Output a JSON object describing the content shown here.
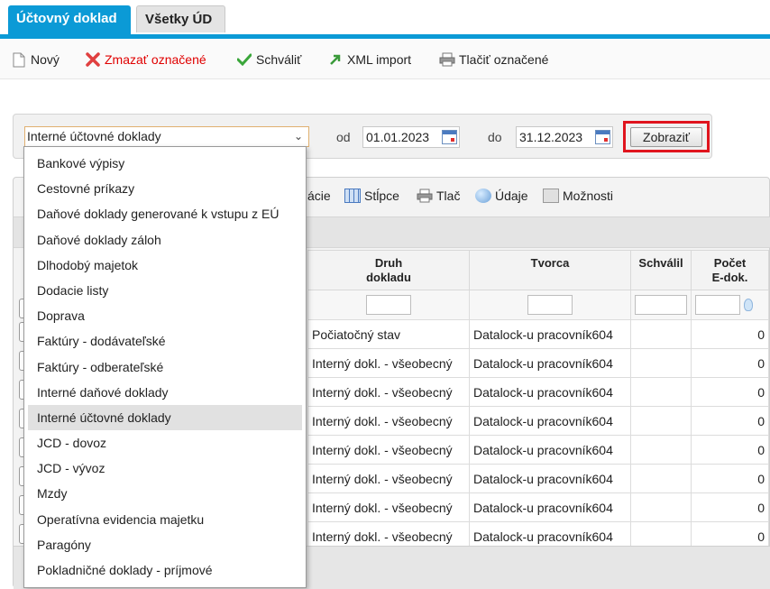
{
  "tabs": [
    {
      "label": "Účtovný doklad",
      "active": true
    },
    {
      "label": "Všetky ÚD",
      "active": false
    }
  ],
  "toolbar": {
    "new": "Nový",
    "delete": "Zmazať označené",
    "approve": "Schváliť",
    "xml_import": "XML import",
    "print": "Tlačiť označené"
  },
  "filter": {
    "type_value": "Interné účtovné doklady",
    "from_label": "od",
    "from_date": "01.01.2023",
    "to_label": "do",
    "to_date": "31.12.2023",
    "show_button": "Zobraziť"
  },
  "grid_toolbar": {
    "actions_partial": "ácie",
    "columns": "Stĺpce",
    "print": "Tlač",
    "data": "Údaje",
    "options": "Možnosti"
  },
  "table": {
    "headers": [
      "Druh dokladu",
      "Tvorca",
      "Schválil",
      "Počet E-dok."
    ],
    "rows": [
      {
        "type": "Počiatočný stav",
        "creator": "Datalock-u pracovník604",
        "approved": "",
        "count": "0"
      },
      {
        "type": "Interný dokl. - všeobecný",
        "creator": "Datalock-u pracovník604",
        "approved": "",
        "count": "0"
      },
      {
        "type": "Interný dokl. - všeobecný",
        "creator": "Datalock-u pracovník604",
        "approved": "",
        "count": "0"
      },
      {
        "type": "Interný dokl. - všeobecný",
        "creator": "Datalock-u pracovník604",
        "approved": "",
        "count": "0"
      },
      {
        "type": "Interný dokl. - všeobecný",
        "creator": "Datalock-u pracovník604",
        "approved": "",
        "count": "0"
      },
      {
        "type": "Interný dokl. - všeobecný",
        "creator": "Datalock-u pracovník604",
        "approved": "",
        "count": "0"
      },
      {
        "type": "Interný dokl. - všeobecný",
        "creator": "Datalock-u pracovník604",
        "approved": "",
        "count": "0"
      },
      {
        "type": "Interný dokl. - všeobecný",
        "creator": "Datalock-u pracovník604",
        "approved": "",
        "count": "0"
      }
    ]
  },
  "dropdown": {
    "options": [
      "Bankové výpisy",
      "Cestovné príkazy",
      "Daňové doklady generované k vstupu z EÚ",
      "Daňové doklady záloh",
      "Dlhodobý majetok",
      "Dodacie listy",
      "Doprava",
      "Faktúry - dodávateľské",
      "Faktúry - odberateľské",
      "Interné daňové doklady",
      "Interné účtovné doklady",
      "JCD - dovoz",
      "JCD - vývoz",
      "Mzdy",
      "Operatívna evidencia majetku",
      "Paragóny",
      "Pokladničné doklady - príjmové"
    ],
    "selected_index": 10
  },
  "colors": {
    "accent": "#0b9ad6",
    "delete": "#e00000",
    "highlight_border": "#e0141e"
  }
}
